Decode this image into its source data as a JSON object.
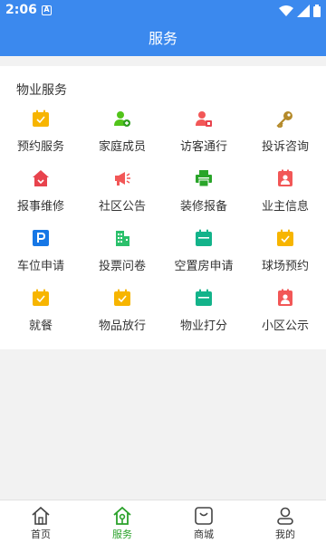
{
  "status_bar": {
    "time": "2:06",
    "notification_glyph": "A"
  },
  "app_bar": {
    "title": "服务"
  },
  "section": {
    "title": "物业服务"
  },
  "services": [
    {
      "label": "预约服务",
      "icon": "calendar-check-icon",
      "color": "#f7b500"
    },
    {
      "label": "家庭成员",
      "icon": "family-members-icon",
      "color": "#52c41a"
    },
    {
      "label": "访客通行",
      "icon": "visitor-pass-icon",
      "color": "#f25757"
    },
    {
      "label": "投诉咨询",
      "icon": "key-icon",
      "color": "#b48a2a"
    },
    {
      "label": "报事维修",
      "icon": "repair-home-icon",
      "color": "#e8434d"
    },
    {
      "label": "社区公告",
      "icon": "megaphone-icon",
      "color": "#f25757"
    },
    {
      "label": "装修报备",
      "icon": "printer-icon",
      "color": "#2aa52a"
    },
    {
      "label": "业主信息",
      "icon": "owner-card-icon",
      "color": "#f25757"
    },
    {
      "label": "车位申请",
      "icon": "parking-icon",
      "color": "#1677e6"
    },
    {
      "label": "投票问卷",
      "icon": "building-icon",
      "color": "#2bc06b"
    },
    {
      "label": "空置房申请",
      "icon": "calendar-icon",
      "color": "#13b38a"
    },
    {
      "label": "球场预约",
      "icon": "calendar-check-icon",
      "color": "#f7b500"
    },
    {
      "label": "就餐",
      "icon": "calendar-check-icon",
      "color": "#f7b500"
    },
    {
      "label": "物品放行",
      "icon": "calendar-check-icon",
      "color": "#f7b500"
    },
    {
      "label": "物业打分",
      "icon": "calendar-icon",
      "color": "#13b38a"
    },
    {
      "label": "小区公示",
      "icon": "owner-card-icon",
      "color": "#f25757"
    }
  ],
  "tabs": [
    {
      "label": "首页",
      "icon": "home-icon",
      "active": false
    },
    {
      "label": "服务",
      "icon": "service-home-icon",
      "active": true
    },
    {
      "label": "商城",
      "icon": "shop-icon",
      "active": false
    },
    {
      "label": "我的",
      "icon": "profile-icon",
      "active": false
    }
  ],
  "colors": {
    "primary": "#3b89ee",
    "active_tab": "#2aa12a",
    "text": "#333333"
  }
}
